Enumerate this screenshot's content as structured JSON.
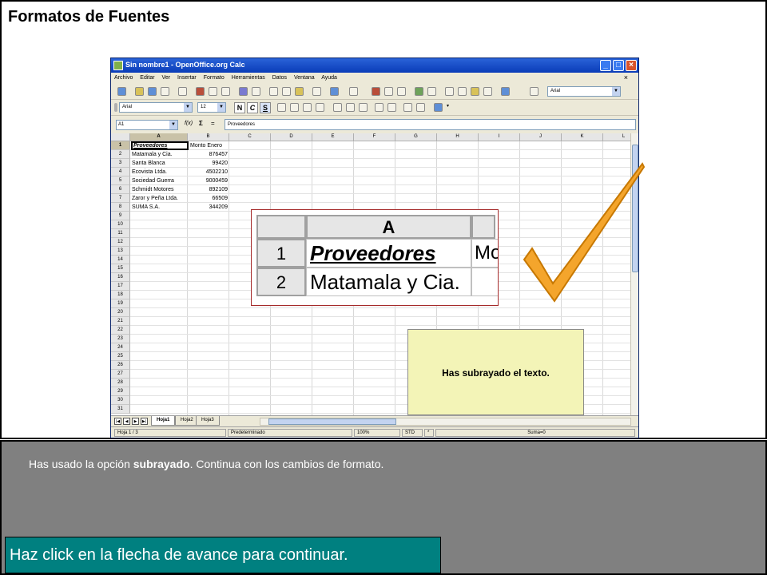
{
  "slide": {
    "title": "Formatos de Fuentes",
    "instruction_pre": "Has usado la opción ",
    "instruction_bold": "subrayado",
    "instruction_post": ". Continua con los cambios de formato.",
    "nav_prompt": "Haz click en la flecha de avance para continuar.",
    "feedback": "Has subrayado el texto."
  },
  "window": {
    "title": "Sin nombre1 - OpenOffice.org Calc",
    "menu": [
      "Archivo",
      "Editar",
      "Ver",
      "Insertar",
      "Formato",
      "Herramientas",
      "Datos",
      "Ventana",
      "Ayuda"
    ],
    "font_name_tb1": "Arial",
    "font_name": "Arial",
    "font_size": "12",
    "bold_label": "N",
    "italic_label": "C",
    "underline_label": "S",
    "cell_ref": "A1",
    "fx_label": "f(x)",
    "sigma_label": "Σ",
    "equals_label": "=",
    "formula_content": "Proveedores"
  },
  "grid": {
    "columns": [
      "A",
      "B",
      "C",
      "D",
      "E",
      "F",
      "G",
      "H",
      "I",
      "J",
      "K",
      "L"
    ],
    "rows": [
      "1",
      "2",
      "3",
      "4",
      "5",
      "6",
      "7",
      "8",
      "9",
      "10",
      "11",
      "12",
      "13",
      "14",
      "15",
      "16",
      "17",
      "18",
      "19",
      "20",
      "21",
      "22",
      "23",
      "24",
      "25",
      "26",
      "27",
      "28",
      "29",
      "30",
      "31"
    ],
    "cells": [
      {
        "a": "Proveedores",
        "b": "Monto Enero"
      },
      {
        "a": "Matamala y Cia.",
        "b": "876457"
      },
      {
        "a": "Santa Blanca",
        "b": "99420"
      },
      {
        "a": "Ecovista Ltda.",
        "b": "4502210"
      },
      {
        "a": "Sociedad Guerra",
        "b": "9000459"
      },
      {
        "a": "Schmidt Motores",
        "b": "892109"
      },
      {
        "a": "Zaror y Peña Ltda.",
        "b": "66509"
      },
      {
        "a": "SUMA S.A.",
        "b": "344209"
      }
    ]
  },
  "sheets": {
    "tabs": [
      "Hoja1",
      "Hoja2",
      "Hoja3"
    ],
    "active": "Hoja1"
  },
  "status": {
    "sheet": "Hoja 1 / 3",
    "style": "Predeterminado",
    "zoom": "100%",
    "mode": "STD",
    "modified": "*",
    "sum": "Suma=0"
  },
  "zoom_view": {
    "col_header": "A",
    "row1": "1",
    "row2": "2",
    "cell1": "Proveedores",
    "cell2": "Matamala y Cia.",
    "cell1_b": "Mo"
  },
  "colors": {
    "title_bar": "#0a3cb8",
    "feedback_bg": "#f3f4b7",
    "check_orange": "#f4a52c",
    "bottom_bg": "#808080",
    "nav_bg": "#008080",
    "zoom_border": "#a52a2a"
  }
}
